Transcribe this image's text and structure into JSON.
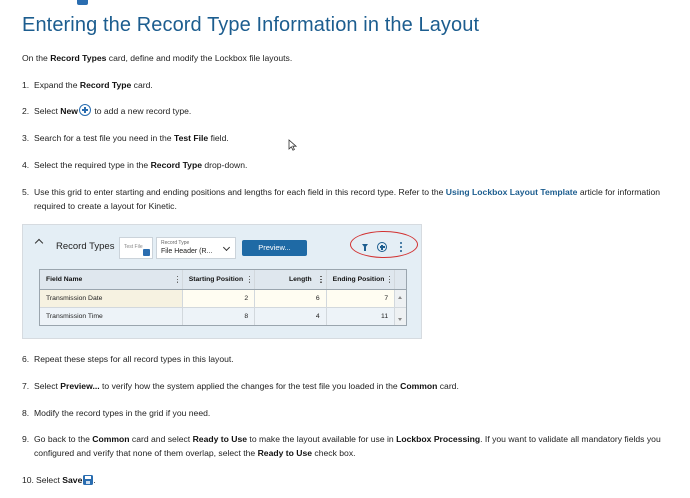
{
  "title": "Entering the Record Type Information in the Layout",
  "intro": {
    "pre": "On the ",
    "bold": "Record Types",
    "post": " card, define and modify the Lockbox file layouts."
  },
  "steps": [
    {
      "n": "1.",
      "a": "Expand the ",
      "b": "Record Type",
      "c": " card."
    },
    {
      "n": "2.",
      "a": "Select ",
      "b": "New",
      "c": " to add a new record type."
    },
    {
      "n": "3.",
      "a": "Search for a test file you need in the ",
      "b": "Test File",
      "c": " field."
    },
    {
      "n": "4.",
      "a": "Select the required type in the ",
      "b": "Record Type",
      "c": " drop-down."
    },
    {
      "n": "5.",
      "a": "Use this grid to enter starting and ending positions and lengths for each field in this record type. Refer to the ",
      "link": "Using Lockbox Layout Template",
      "c": " article for information",
      "line2": "required to create a layout for Kinetic."
    },
    {
      "n": "6.",
      "a": "Repeat these steps for all record types in this layout."
    },
    {
      "n": "7.",
      "a": "Select ",
      "b": "Preview...",
      "c": " to verify how the system applied the changes for the test file you loaded in the ",
      "d": "Common",
      "e": " card."
    },
    {
      "n": "8.",
      "a": "Modify the record types in the grid if you need."
    },
    {
      "n": "9.",
      "a": "Go back to the ",
      "b": "Common",
      "c": " card and select ",
      "d": "Ready to Use",
      "e": " to make the layout available for use in ",
      "f": "Lockbox Processing",
      "g": ". If you want to validate all mandatory fields you",
      "line2a": "configured and verify that none of them overlap, select the ",
      "line2b": "Ready to Use",
      "line2c": " check box."
    },
    {
      "n": "10.",
      "a": "Select ",
      "b": "Save",
      "c": "."
    }
  ],
  "panel": {
    "title": "Record Types",
    "test_file_label": "Test File",
    "record_type_label": "Record Type",
    "record_type_value": "File Header (R...",
    "preview_label": "Preview...",
    "columns": [
      "Field Name",
      "Starting Position",
      "Length",
      "Ending Position"
    ],
    "rows": [
      [
        "Transmission Date",
        "2",
        "6",
        "7"
      ],
      [
        "Transmission Time",
        "8",
        "4",
        "11"
      ]
    ]
  },
  "colors": {
    "heading": "#1c5d8f",
    "accent": "#2a6db0",
    "highlight": "#d23232"
  }
}
